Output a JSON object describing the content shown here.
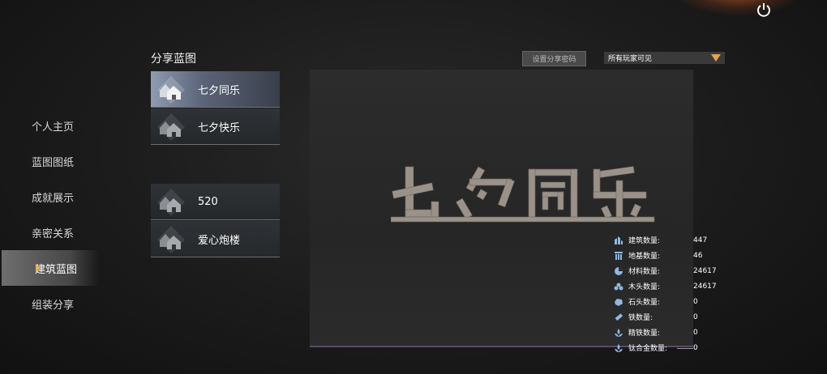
{
  "nav": {
    "items": [
      {
        "label": "个人主页",
        "active": false
      },
      {
        "label": "蓝图图纸",
        "active": false
      },
      {
        "label": "成就展示",
        "active": false
      },
      {
        "label": "亲密关系",
        "active": false
      },
      {
        "label": "建筑蓝图",
        "active": true
      },
      {
        "label": "组装分享",
        "active": false
      }
    ]
  },
  "header": {
    "title": "分享蓝图",
    "password_button": "设置分享密码",
    "visibility_selected": "所有玩家可见"
  },
  "blueprints": [
    {
      "label": "七夕同乐",
      "active": true
    },
    {
      "label": "七夕快乐",
      "active": false
    },
    {
      "label": "520",
      "active": false
    },
    {
      "label": "爱心炮楼",
      "active": false
    }
  ],
  "stats": [
    {
      "label": "建筑数量:",
      "value": "447",
      "icon": "building-icon"
    },
    {
      "label": "地基数量:",
      "value": "46",
      "icon": "foundation-icon"
    },
    {
      "label": "材料数量:",
      "value": "24617",
      "icon": "material-icon"
    },
    {
      "label": "木头数量:",
      "value": "24617",
      "icon": "wood-icon"
    },
    {
      "label": "石头数量:",
      "value": "0",
      "icon": "stone-icon"
    },
    {
      "label": "铁数量:",
      "value": "0",
      "icon": "iron-icon"
    },
    {
      "label": "精铁数量:",
      "value": "0",
      "icon": "refined-iron-icon"
    },
    {
      "label": "钛合金数量:",
      "value": "0",
      "icon": "titanium-icon"
    }
  ],
  "colors": {
    "accent": "#e8a34a",
    "active_card": "#8f9bb0",
    "nav_active": "#8c8c8c"
  }
}
